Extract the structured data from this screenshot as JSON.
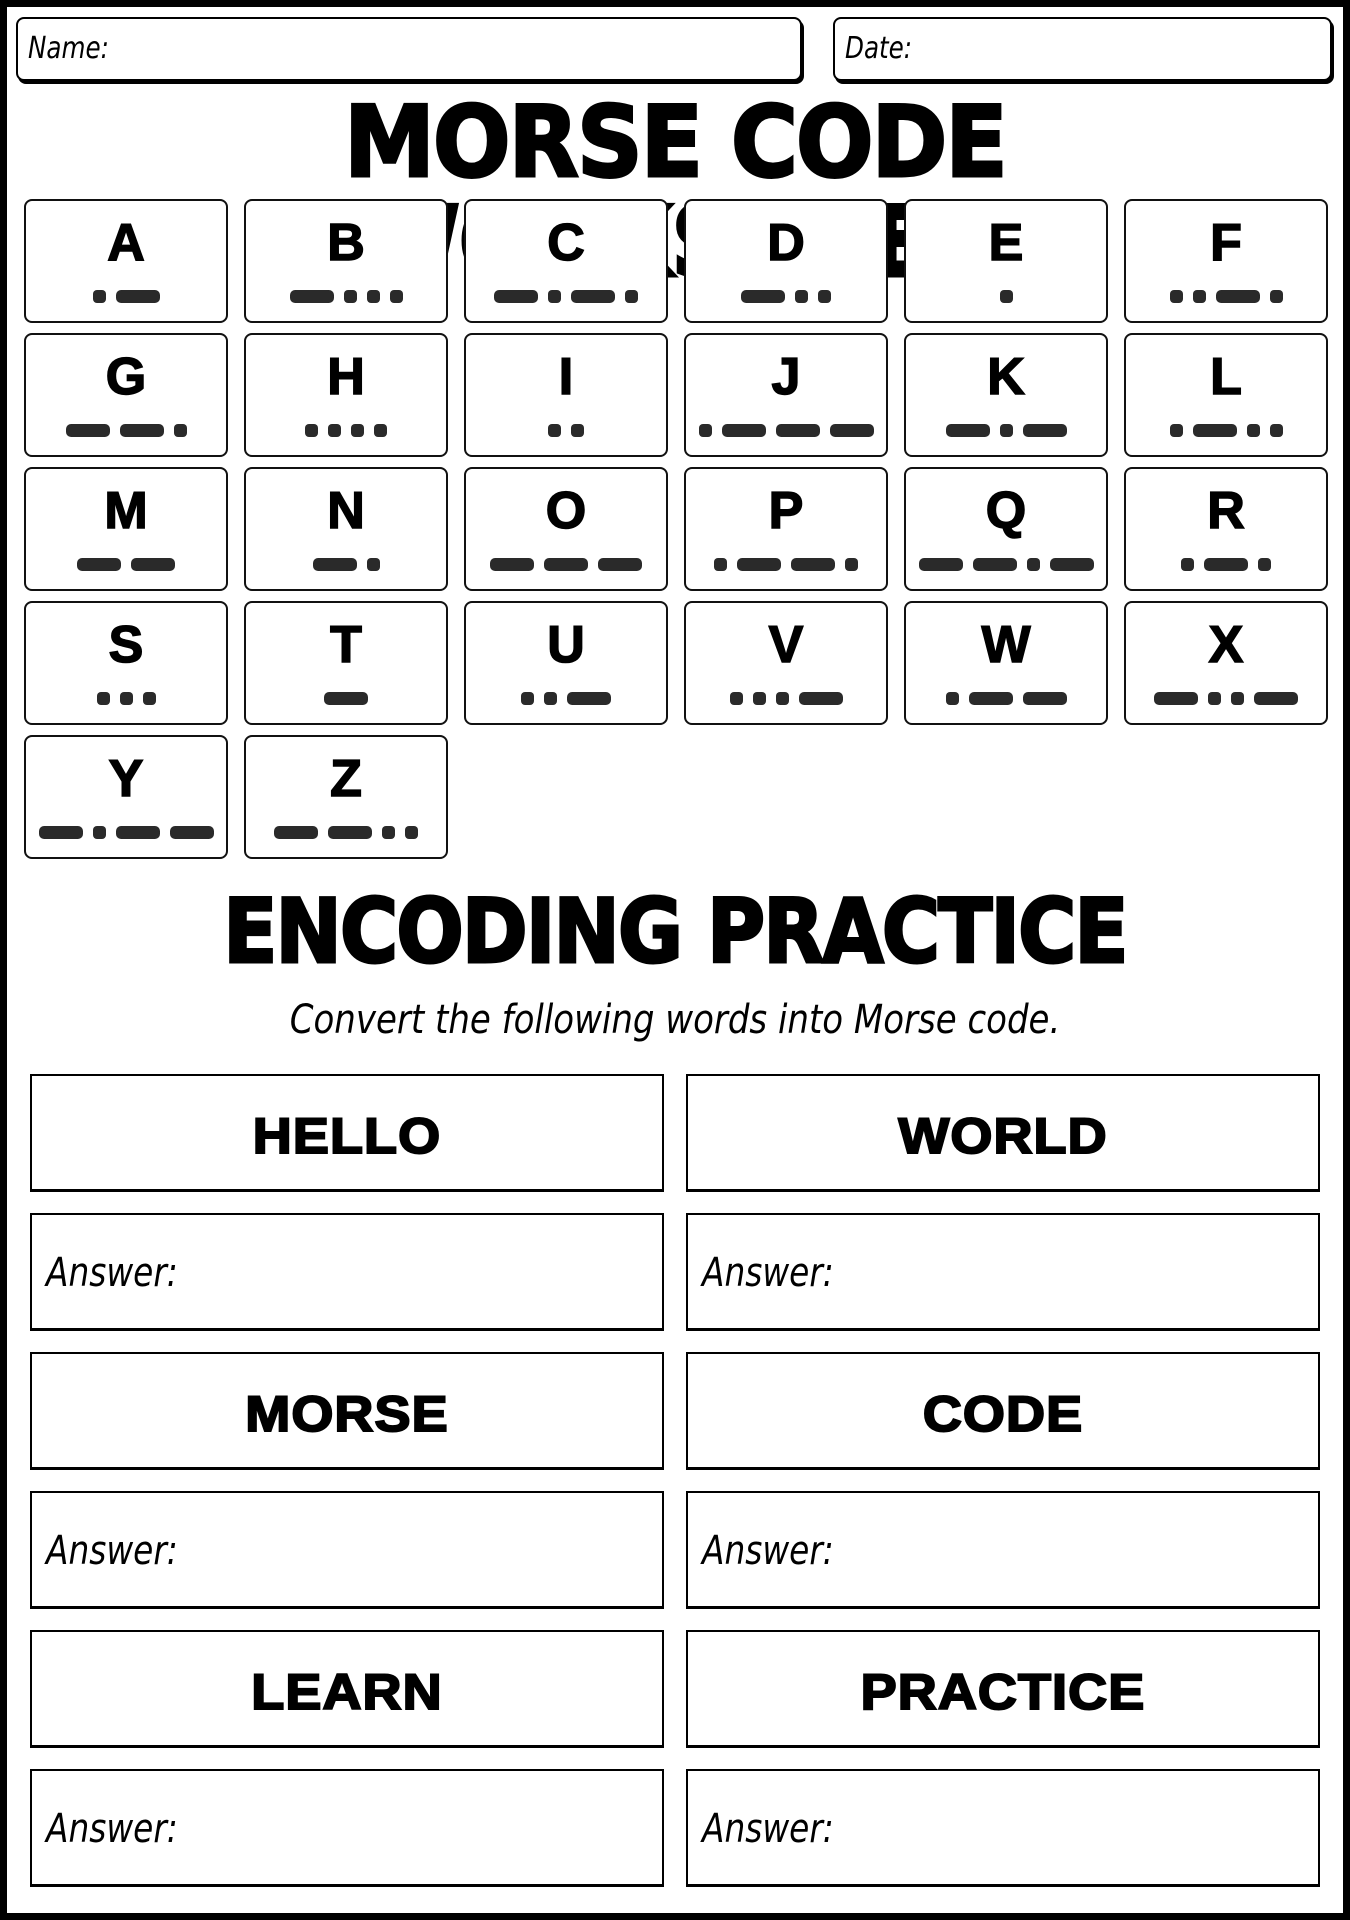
{
  "header": {
    "name_label": "Name:",
    "date_label": "Date:"
  },
  "title": "MORSE CODE WORKSHEET",
  "alphabet": [
    {
      "letter": "A",
      "code": ".-"
    },
    {
      "letter": "B",
      "code": "-..."
    },
    {
      "letter": "C",
      "code": "-.-."
    },
    {
      "letter": "D",
      "code": "-.."
    },
    {
      "letter": "E",
      "code": "."
    },
    {
      "letter": "F",
      "code": "..-."
    },
    {
      "letter": "G",
      "code": "--."
    },
    {
      "letter": "H",
      "code": "...."
    },
    {
      "letter": "I",
      "code": ".."
    },
    {
      "letter": "J",
      "code": ".---"
    },
    {
      "letter": "K",
      "code": "-.-"
    },
    {
      "letter": "L",
      "code": ".-.."
    },
    {
      "letter": "M",
      "code": "--"
    },
    {
      "letter": "N",
      "code": "-."
    },
    {
      "letter": "O",
      "code": "---"
    },
    {
      "letter": "P",
      "code": ".--."
    },
    {
      "letter": "Q",
      "code": "--.-"
    },
    {
      "letter": "R",
      "code": ".-."
    },
    {
      "letter": "S",
      "code": "..."
    },
    {
      "letter": "T",
      "code": "-"
    },
    {
      "letter": "U",
      "code": "..-"
    },
    {
      "letter": "V",
      "code": "...-"
    },
    {
      "letter": "W",
      "code": ".--"
    },
    {
      "letter": "X",
      "code": "-..-"
    },
    {
      "letter": "Y",
      "code": "-.--"
    },
    {
      "letter": "Z",
      "code": "--.."
    }
  ],
  "practice": {
    "title": "ENCODING PRACTICE",
    "instruction": "Convert the following words into Morse code.",
    "answer_label": "Answer:",
    "words": [
      "HELLO",
      "WORLD",
      "MORSE",
      "CODE",
      "LEARN",
      "PRACTICE"
    ]
  },
  "colors": {
    "frame": "#000000",
    "page": "#ffffff",
    "morse_mark": "#2a2a2a"
  }
}
